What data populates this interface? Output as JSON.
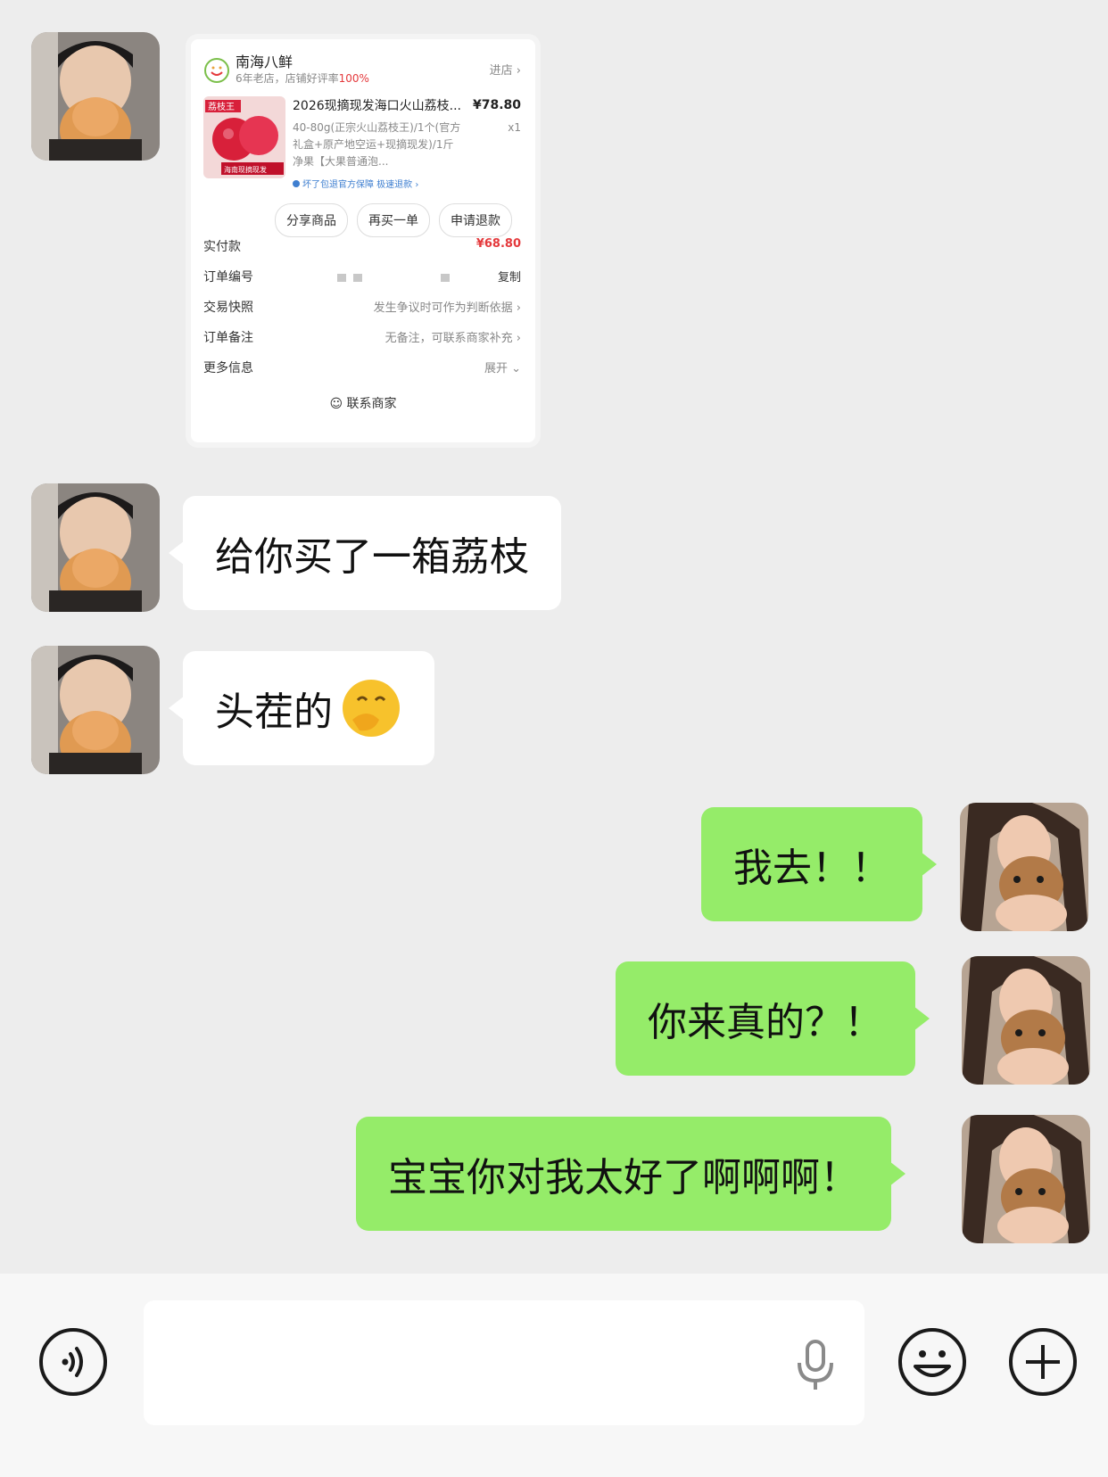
{
  "order_card": {
    "shop_name": "南海八鲜",
    "shop_years": "6年老店，店铺好评率",
    "shop_rate": "100%",
    "enter_shop": "进店 ›",
    "product_image_text_1": "荔枝王",
    "product_image_text_2": "海南现摘现发",
    "product_title": "2026现摘现发海口火山荔枝...",
    "product_price": "¥78.80",
    "product_spec": "40-80g(正宗火山荔枝王)/1个(官方礼盒+原产地空运+现摘现发)/1斤净果【大果普通泡...",
    "product_qty": "x1",
    "guarantee": "坏了包退官方保障  极速退款 ›",
    "buttons": [
      "分享商品",
      "再买一单",
      "申请退款"
    ],
    "rows": {
      "paid_label": "实付款",
      "paid_value": "¥68.80",
      "order_no_label": "订单编号",
      "copy": "复制",
      "snapshot_label": "交易快照",
      "snapshot_value": "发生争议时可作为判断依据 ›",
      "remark_label": "订单备注",
      "remark_value": "无备注，可联系商家补充 ›",
      "more_label": "更多信息",
      "more_value": "展开 ⌄"
    },
    "contact": "联系商家"
  },
  "messages": [
    {
      "side": "in",
      "text": "给你买了一箱荔枝"
    },
    {
      "side": "in",
      "text": "头茬的",
      "emoji": "hand-over-mouth-emoji"
    },
    {
      "side": "out",
      "text": "我去！！"
    },
    {
      "side": "out",
      "text": "你来真的？！"
    },
    {
      "side": "out",
      "text": "宝宝你对我太好了啊啊啊！"
    }
  ],
  "colors": {
    "background": "#ededed",
    "incoming_bubble": "#ffffff",
    "outgoing_bubble": "#95ec69",
    "price_red": "#e4393c"
  },
  "input_bar": {
    "icons": [
      "voice-icon",
      "microphone-icon",
      "emoji-icon",
      "plus-icon"
    ]
  }
}
